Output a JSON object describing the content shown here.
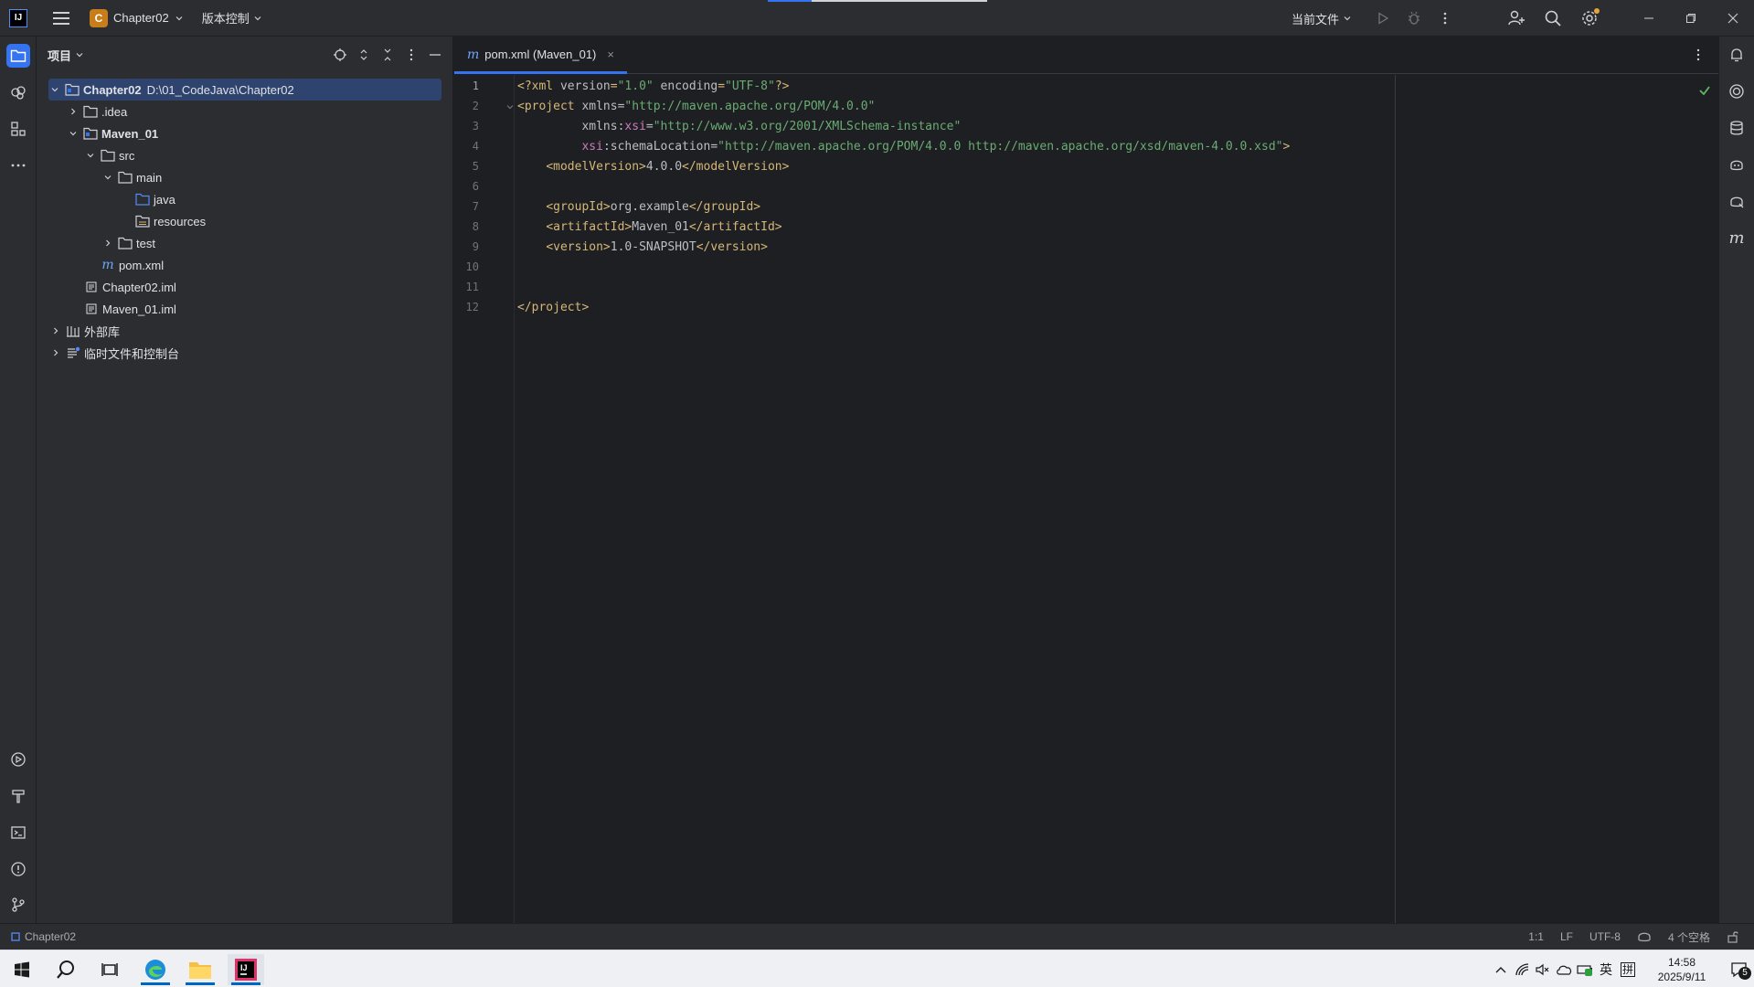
{
  "titlebar": {
    "app_icon_label": "IJ",
    "project_badge": "C",
    "project_name": "Chapter02",
    "vcs_label": "版本控制",
    "run_config_label": "当前文件",
    "icons": [
      "menu-icon",
      "chevron-down-icon",
      "run-icon",
      "debug-icon",
      "more-vertical-icon",
      "add-user-icon",
      "search-icon",
      "settings-icon",
      "minimize-icon",
      "restore-icon",
      "close-icon"
    ]
  },
  "left_strip": {
    "top_icons": [
      "folder-icon",
      "extensions-icon",
      "structure-icon",
      "more-horizontal-icon"
    ],
    "bottom_icons": [
      "services-icon",
      "build-icon",
      "terminal-icon",
      "problems-icon",
      "git-icon"
    ]
  },
  "project_panel": {
    "title": "项目",
    "tools": [
      "locate-icon",
      "expand-all-icon",
      "collapse-all-icon",
      "options-icon",
      "hide-icon"
    ],
    "tree": [
      {
        "label": "Chapter02",
        "path": "D:\\01_CodeJava\\Chapter02",
        "depth": 0,
        "expanded": true,
        "icon": "module-folder-icon",
        "bold": true,
        "selected": true
      },
      {
        "label": ".idea",
        "depth": 1,
        "expanded": false,
        "icon": "folder-icon"
      },
      {
        "label": "Maven_01",
        "depth": 1,
        "expanded": true,
        "icon": "module-folder-icon",
        "bold": true
      },
      {
        "label": "src",
        "depth": 2,
        "expanded": true,
        "icon": "folder-icon"
      },
      {
        "label": "main",
        "depth": 3,
        "expanded": true,
        "icon": "folder-icon"
      },
      {
        "label": "java",
        "depth": 4,
        "icon": "source-folder-icon"
      },
      {
        "label": "resources",
        "depth": 4,
        "icon": "resources-folder-icon"
      },
      {
        "label": "test",
        "depth": 3,
        "expanded": false,
        "icon": "folder-icon"
      },
      {
        "label": "pom.xml",
        "depth": 2,
        "icon": "maven-file-icon"
      },
      {
        "label": "Chapter02.iml",
        "depth": 1,
        "icon": "iml-file-icon"
      },
      {
        "label": "Maven_01.iml",
        "depth": 1,
        "icon": "iml-file-icon"
      },
      {
        "label": "外部库",
        "depth": 0,
        "expanded": false,
        "icon": "library-icon"
      },
      {
        "label": "临时文件和控制台",
        "depth": 0,
        "expanded": false,
        "icon": "scratches-icon"
      }
    ]
  },
  "editor": {
    "tab": {
      "icon_glyph": "m",
      "label": "pom.xml (Maven_01)",
      "close_glyph": "×"
    },
    "lines": [
      {
        "n": "1",
        "tokens": [
          [
            "tag",
            "<?xml "
          ],
          [
            "attr",
            "version"
          ],
          [
            "tag",
            "="
          ],
          [
            "str",
            "\"1.0\""
          ],
          [
            "attr",
            " encoding"
          ],
          [
            "tag",
            "="
          ],
          [
            "str",
            "\"UTF-8\""
          ],
          [
            "tag",
            "?>"
          ]
        ]
      },
      {
        "n": "2",
        "tokens": [
          [
            "tag",
            "<project "
          ],
          [
            "attr",
            "xmlns"
          ],
          [
            "txt",
            "="
          ],
          [
            "str",
            "\"http://maven.apache.org/POM/4.0.0\""
          ]
        ]
      },
      {
        "n": "3",
        "tokens": [
          [
            "txt",
            "         "
          ],
          [
            "attr",
            "xmlns:"
          ],
          [
            "ns",
            "xsi"
          ],
          [
            "txt",
            "="
          ],
          [
            "str",
            "\"http://www.w3.org/2001/XMLSchema-instance\""
          ]
        ]
      },
      {
        "n": "4",
        "tokens": [
          [
            "txt",
            "         "
          ],
          [
            "ns",
            "xsi"
          ],
          [
            "attr",
            ":schemaLocation"
          ],
          [
            "txt",
            "="
          ],
          [
            "str",
            "\"http://maven.apache.org/POM/4.0.0 http://maven.apache.org/xsd/maven-4.0.0.xsd\""
          ],
          [
            "tag",
            ">"
          ]
        ]
      },
      {
        "n": "5",
        "tokens": [
          [
            "txt",
            "    "
          ],
          [
            "tag",
            "<modelVersion>"
          ],
          [
            "txt",
            "4.0.0"
          ],
          [
            "tag",
            "</modelVersion>"
          ]
        ]
      },
      {
        "n": "6",
        "tokens": []
      },
      {
        "n": "7",
        "tokens": [
          [
            "txt",
            "    "
          ],
          [
            "tag",
            "<groupId>"
          ],
          [
            "txt",
            "org.example"
          ],
          [
            "tag",
            "</groupId>"
          ]
        ]
      },
      {
        "n": "8",
        "tokens": [
          [
            "txt",
            "    "
          ],
          [
            "tag",
            "<artifactId>"
          ],
          [
            "txt",
            "Maven_01"
          ],
          [
            "tag",
            "</artifactId>"
          ]
        ]
      },
      {
        "n": "9",
        "tokens": [
          [
            "txt",
            "    "
          ],
          [
            "tag",
            "<version>"
          ],
          [
            "txt",
            "1.0-SNAPSHOT"
          ],
          [
            "tag",
            "</version>"
          ]
        ]
      },
      {
        "n": "10",
        "tokens": []
      },
      {
        "n": "11",
        "tokens": []
      },
      {
        "n": "12",
        "tokens": [
          [
            "tag",
            "</project>"
          ]
        ]
      }
    ]
  },
  "right_strip": {
    "icons": [
      "notifications-icon",
      "ai-assistant-icon",
      "database-icon",
      "copilot-icon",
      "code-with-me-icon",
      "maven-icon"
    ]
  },
  "statusbar": {
    "breadcrumb": "Chapter02",
    "position": "1:1",
    "line_sep": "LF",
    "encoding": "UTF-8",
    "indent": "4 个空格"
  },
  "taskbar": {
    "apps": [
      "windows-start-icon",
      "search-icon",
      "task-view-icon",
      "edge-icon",
      "file-explorer-icon",
      "intellij-icon"
    ],
    "tray_ime": "英",
    "tray_grid": "拼",
    "time": "14:58",
    "date": "2025/9/11",
    "notif_count": "5"
  },
  "colors": {
    "accent": "#3574f0",
    "tag": "#d5b778",
    "string": "#6aab73",
    "namespace": "#c77dbb",
    "background": "#1e1f22",
    "panel": "#2b2d30",
    "selection": "#2e436e"
  }
}
